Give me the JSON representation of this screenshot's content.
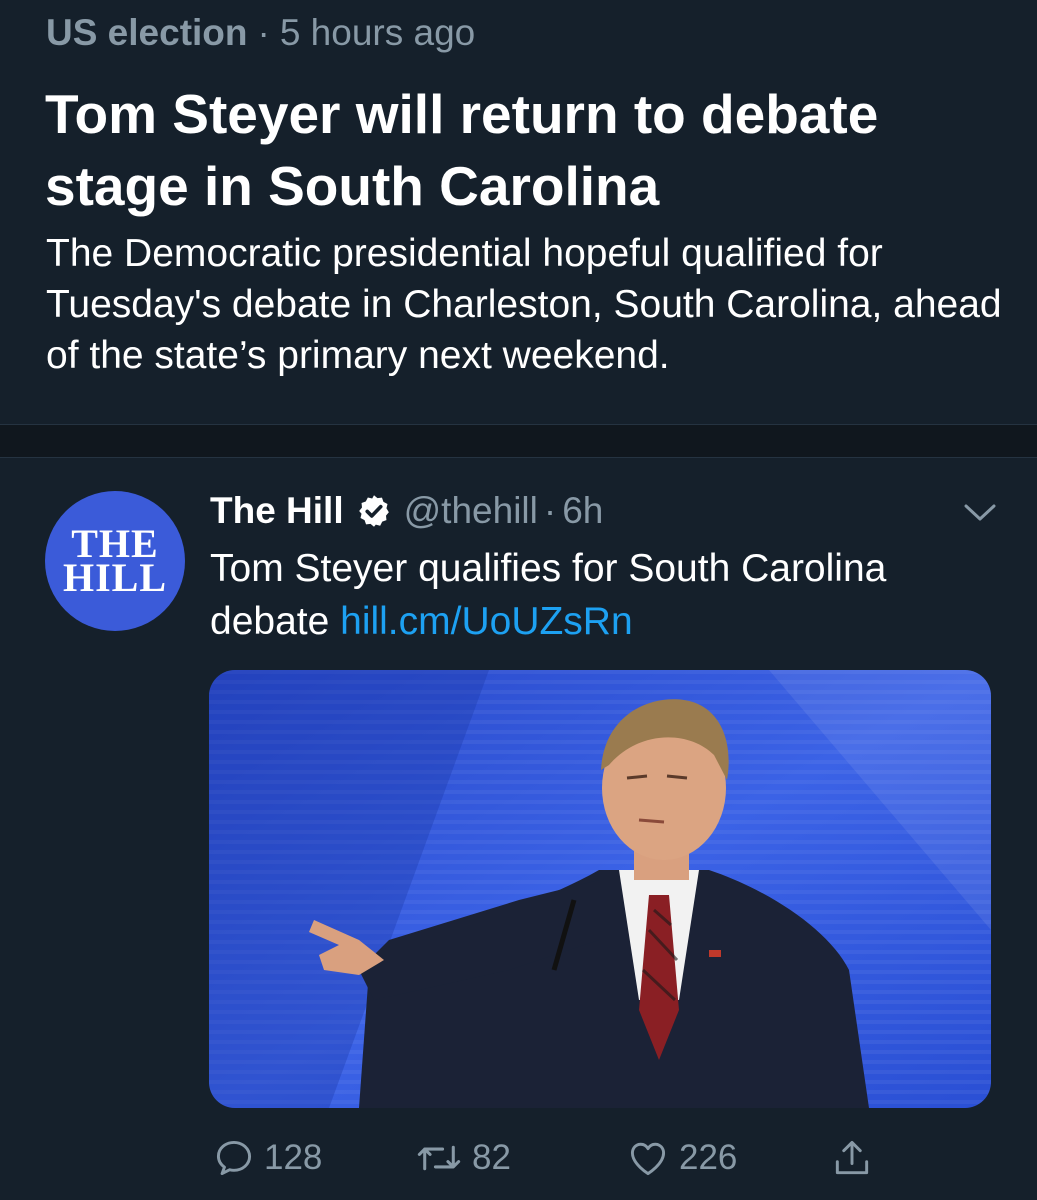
{
  "topic": {
    "category": "US election",
    "separator": "·",
    "timestamp": "5 hours ago",
    "title": "Tom Steyer will return to debate stage in South Carolina",
    "summary": "The Democratic presidential hopeful qualified for Tuesday's debate in Charleston, South Carolina, ahead of the state’s primary next weekend."
  },
  "tweet": {
    "avatar": {
      "line1": "THE",
      "line2": "HILL",
      "color": "#3b5bd9"
    },
    "author_name": "The Hill",
    "verified_icon": "verified-badge-icon",
    "handle": "@thehill",
    "separator": "·",
    "time": "6h",
    "menu_icon": "chevron-down-icon",
    "text": "Tom Steyer qualifies for South Carolina debate ",
    "link": "hill.cm/UoUZsRn",
    "media_icon": "photo-man-speaking-at-debate-podium"
  },
  "actions": {
    "reply": {
      "icon": "reply-icon",
      "count": "128"
    },
    "retweet": {
      "icon": "retweet-icon",
      "count": "82"
    },
    "like": {
      "icon": "heart-icon",
      "count": "226"
    },
    "share": {
      "icon": "share-icon"
    }
  },
  "colors": {
    "background": "#15202b",
    "secondary_text": "#8899a6",
    "link": "#1da1f2",
    "divider": "#10171e"
  }
}
